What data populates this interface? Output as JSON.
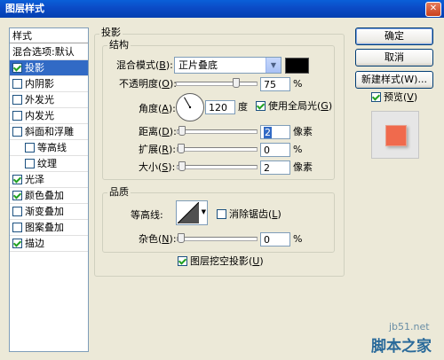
{
  "window": {
    "title": "图层样式",
    "close_glyph": "✕"
  },
  "style_list": {
    "header": "样式",
    "items": [
      {
        "label": "混合选项:默认",
        "checkbox": false,
        "checked": false,
        "selected": false,
        "indent": false
      },
      {
        "label": "投影",
        "checkbox": true,
        "checked": true,
        "selected": true,
        "indent": false
      },
      {
        "label": "内阴影",
        "checkbox": true,
        "checked": false,
        "selected": false,
        "indent": false
      },
      {
        "label": "外发光",
        "checkbox": true,
        "checked": false,
        "selected": false,
        "indent": false
      },
      {
        "label": "内发光",
        "checkbox": true,
        "checked": false,
        "selected": false,
        "indent": false
      },
      {
        "label": "斜面和浮雕",
        "checkbox": true,
        "checked": false,
        "selected": false,
        "indent": false
      },
      {
        "label": "等高线",
        "checkbox": true,
        "checked": false,
        "selected": false,
        "indent": true
      },
      {
        "label": "纹理",
        "checkbox": true,
        "checked": false,
        "selected": false,
        "indent": true
      },
      {
        "label": "光泽",
        "checkbox": true,
        "checked": true,
        "selected": false,
        "indent": false
      },
      {
        "label": "颜色叠加",
        "checkbox": true,
        "checked": true,
        "selected": false,
        "indent": false
      },
      {
        "label": "渐变叠加",
        "checkbox": true,
        "checked": false,
        "selected": false,
        "indent": false
      },
      {
        "label": "图案叠加",
        "checkbox": true,
        "checked": false,
        "selected": false,
        "indent": false
      },
      {
        "label": "描边",
        "checkbox": true,
        "checked": true,
        "selected": false,
        "indent": false
      }
    ]
  },
  "panel": {
    "section_title": "投影",
    "structure": {
      "title": "结构",
      "blend_mode": {
        "label": "混合模式",
        "key": "B",
        "value": "正片叠底",
        "color": "#000000"
      },
      "opacity": {
        "label": "不透明度",
        "key": "O",
        "value": "75",
        "unit": "%",
        "fraction": 0.75
      },
      "angle": {
        "label": "角度",
        "key": "A",
        "value": "120",
        "unit": "度",
        "degrees": 120,
        "global_light": {
          "label": "使用全局光",
          "key": "G",
          "checked": true
        }
      },
      "distance": {
        "label": "距离",
        "key": "D",
        "value": "2",
        "unit": "像素",
        "fraction": 0.01
      },
      "spread": {
        "label": "扩展",
        "key": "R",
        "value": "0",
        "unit": "%",
        "fraction": 0
      },
      "size": {
        "label": "大小",
        "key": "S",
        "value": "2",
        "unit": "像素",
        "fraction": 0.01
      }
    },
    "quality": {
      "title": "品质",
      "contour": {
        "label": "等高线",
        "anti_alias": {
          "label": "消除锯齿",
          "key": "L",
          "checked": false
        }
      },
      "noise": {
        "label": "杂色",
        "key": "N",
        "value": "0",
        "unit": "%",
        "fraction": 0
      }
    },
    "knockout": {
      "label": "图层挖空投影",
      "key": "U",
      "checked": true
    }
  },
  "buttons": {
    "ok": "确定",
    "cancel": "取消",
    "new_style": "新建样式(W)...",
    "preview": {
      "label": "预览",
      "key": "V",
      "checked": true
    }
  },
  "watermark": {
    "line1": "jb51.net",
    "line2": "脚本之家"
  }
}
